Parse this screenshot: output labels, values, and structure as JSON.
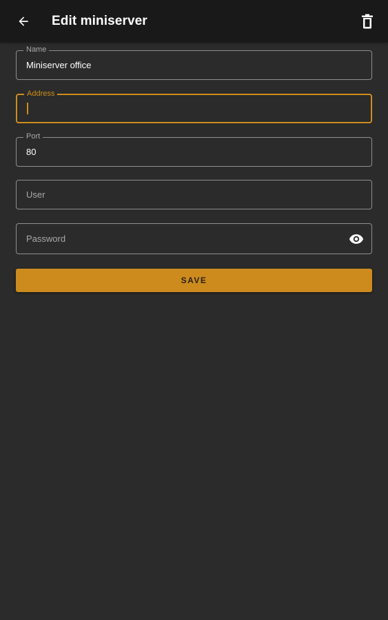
{
  "appbar": {
    "back_icon": "arrow-left-icon",
    "title": "Edit miniserver",
    "delete_icon": "trash-icon"
  },
  "form": {
    "name": {
      "label": "Name",
      "value": "Miniserver office"
    },
    "address": {
      "label": "Address",
      "value": ""
    },
    "port": {
      "label": "Port",
      "value": "80"
    },
    "user": {
      "placeholder": "User",
      "value": ""
    },
    "password": {
      "placeholder": "Password",
      "value": "",
      "visibility_icon": "eye-icon"
    }
  },
  "save_button": {
    "label": "SAVE"
  },
  "colors": {
    "accent": "#cd8b1d",
    "background": "#2a2b2a",
    "appbar": "#181918",
    "outline": "#8e8f8e"
  }
}
